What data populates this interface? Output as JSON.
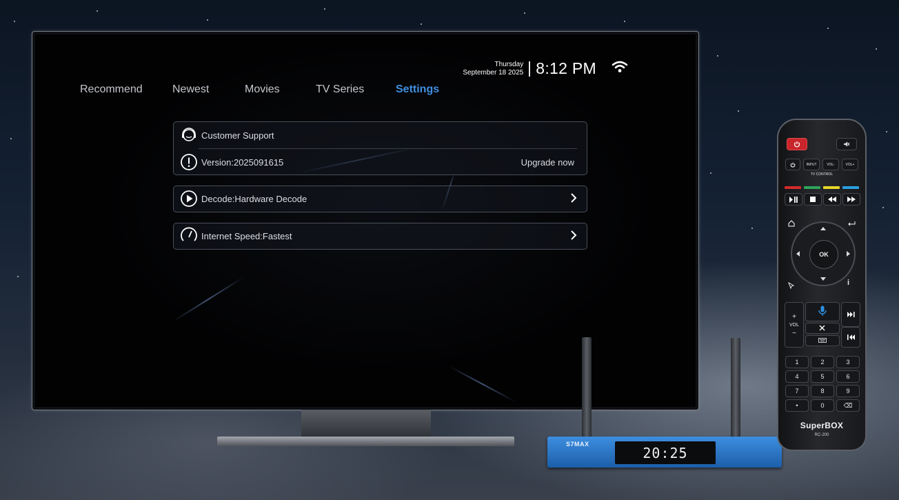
{
  "tv": {
    "header": {
      "day": "Thursday",
      "date": "September 18 2025",
      "time": "8:12 PM",
      "wifi_icon": "wifi-icon"
    },
    "nav": {
      "items": [
        {
          "label": "Recommend",
          "active": false
        },
        {
          "label": "Newest",
          "active": false
        },
        {
          "label": "Movies",
          "active": false
        },
        {
          "label": "TV Series",
          "active": false
        },
        {
          "label": "Settings",
          "active": true
        }
      ]
    },
    "settings": {
      "customer_support": "Customer Support",
      "version": "Version:2025091615",
      "upgrade": "Upgrade now",
      "decode": "Decode:Hardware Decode",
      "internet_speed": "Internet Speed:Fastest"
    },
    "colors": {
      "active_tab": "#3f8fe0",
      "text": "#dcdfe4"
    }
  },
  "box": {
    "label": "S7MAX",
    "display": "20:25"
  },
  "remote": {
    "buttons": {
      "input": "INPUT",
      "vol_minus": "VOL-",
      "vol_plus": "VOL+",
      "tv_control": "TV CONTROL",
      "ok": "OK",
      "info": "i",
      "plus": "+",
      "vol": "VOL",
      "minus": "−",
      "digits": [
        "1",
        "2",
        "3",
        "4",
        "5",
        "6",
        "7",
        "8",
        "9",
        "•",
        "0",
        "⌫"
      ]
    },
    "brand": "SuperBOX",
    "model": "RC-200"
  }
}
